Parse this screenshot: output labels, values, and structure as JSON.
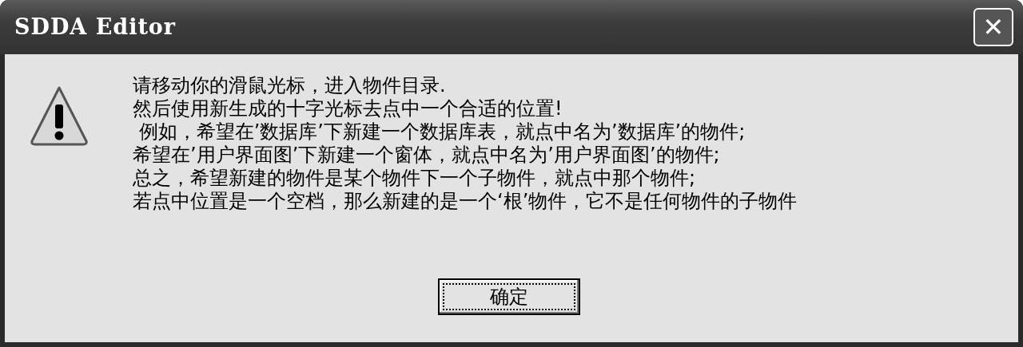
{
  "window": {
    "title": "SDDA Editor",
    "close": "✕"
  },
  "message": {
    "lines": [
      "请移动你的滑鼠光标，进入物件目录.",
      "然后使用新生成的十字光标去点中一个合适的位置!",
      " 例如，希望在’数据库’下新建一个数据库表，就点中名为’数据库’的物件;",
      "希望在’用户界面图’下新建一个窗体，就点中名为’用户界面图’的物件;",
      "总之，希望新建的物件是某个物件下一个子物件，就点中那个物件;",
      "若点中位置是一个空档，那么新建的是一个‘根’物件，它不是任何物件的子物件"
    ]
  },
  "buttons": [
    {
      "label": "确定",
      "focused": true
    }
  ]
}
